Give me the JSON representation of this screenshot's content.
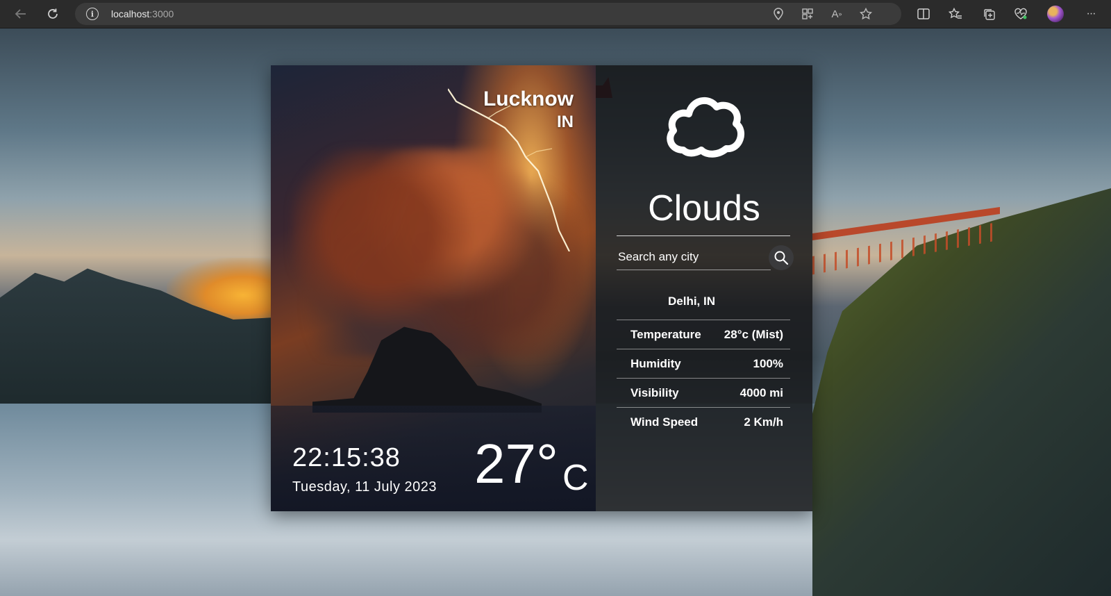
{
  "browser": {
    "url_host": "localhost",
    "url_port": ":3000",
    "icons": {
      "back": "arrow-left-icon",
      "reload": "reload-icon",
      "site_info": "info-icon",
      "location": "location-icon",
      "apps": "apps-icon",
      "read_aloud": "read-aloud-icon",
      "favorite": "star-icon",
      "split_screen": "split-screen-icon",
      "favorites": "favorites-icon",
      "collections": "collections-icon",
      "browser_essentials": "heart-icon",
      "profile": "avatar",
      "more": "more-icon"
    },
    "read_aloud_glyph": "A",
    "more_glyph": "···"
  },
  "weather": {
    "city": "Lucknow",
    "country": "IN",
    "time": "22:15:38",
    "date": "Tuesday, 11 July 2023",
    "temperature": "27°",
    "temperature_unit": "C",
    "condition": "Clouds",
    "condition_icon": "cloud-icon"
  },
  "search": {
    "placeholder": "Search any city",
    "button_icon": "search-icon"
  },
  "result": {
    "city": "Delhi, IN",
    "stats": [
      {
        "label": "Temperature",
        "value": "28°c (Mist)"
      },
      {
        "label": "Humidity",
        "value": "100%"
      },
      {
        "label": "Visibility",
        "value": "4000 mi"
      },
      {
        "label": "Wind Speed",
        "value": "2 Km/h"
      }
    ]
  },
  "colors": {
    "panel_dark": "#121214",
    "text": "#ffffff",
    "chrome": "#2b2b2b",
    "address_bar": "#3b3b3b",
    "search_button": "#3a3a3c"
  }
}
